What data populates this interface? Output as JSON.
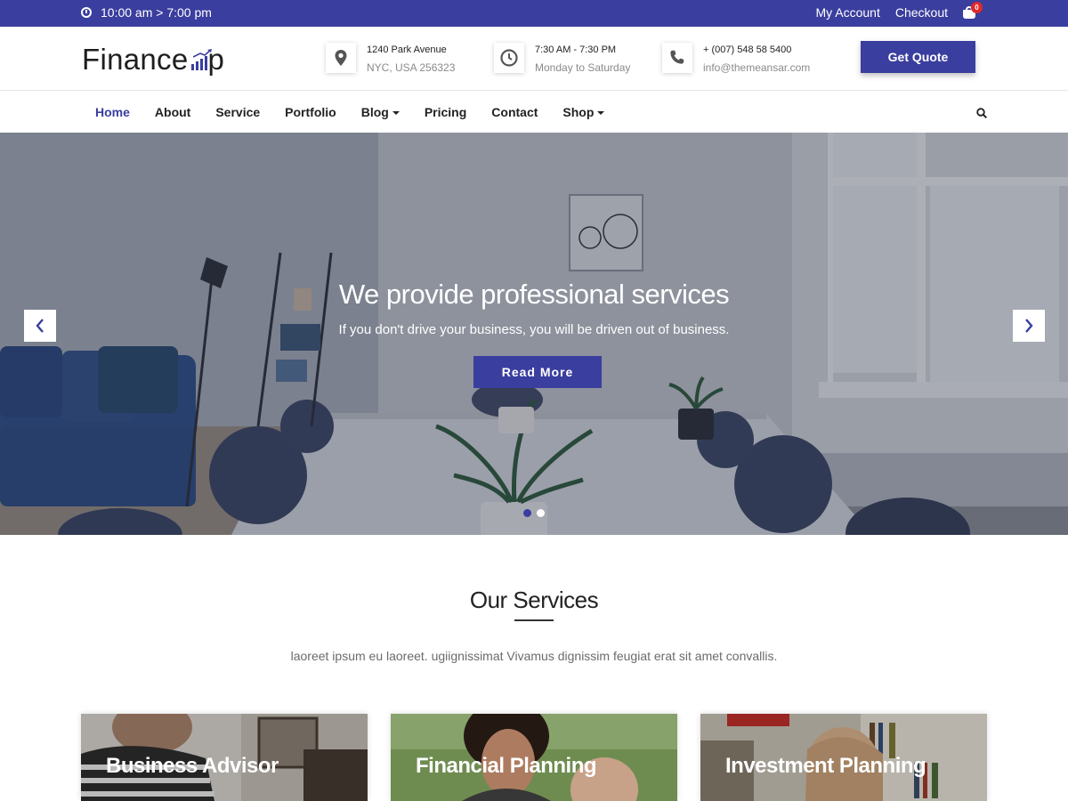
{
  "topbar": {
    "hours": "10:00 am > 7:00 pm",
    "my_account": "My Account",
    "checkout": "Checkout",
    "cart_count": "0"
  },
  "header": {
    "logo_text": "Finance",
    "logo_text_end": "p",
    "address": {
      "line1": "1240 Park Avenue",
      "line2": "NYC, USA 256323"
    },
    "hours": {
      "line1": "7:30 AM - 7:30 PM",
      "line2": "Monday to Saturday"
    },
    "contact": {
      "line1": "+ (007) 548 58 5400",
      "line2": "info@themeansar.com"
    },
    "quote_button": "Get Quote"
  },
  "nav": {
    "items": [
      {
        "label": "Home",
        "active": true,
        "dropdown": false
      },
      {
        "label": "About",
        "active": false,
        "dropdown": false
      },
      {
        "label": "Service",
        "active": false,
        "dropdown": false
      },
      {
        "label": "Portfolio",
        "active": false,
        "dropdown": false
      },
      {
        "label": "Blog",
        "active": false,
        "dropdown": true
      },
      {
        "label": "Pricing",
        "active": false,
        "dropdown": false
      },
      {
        "label": "Contact",
        "active": false,
        "dropdown": false
      },
      {
        "label": "Shop",
        "active": false,
        "dropdown": true
      }
    ]
  },
  "hero": {
    "title": "We provide professional services",
    "subtitle": "If you don't drive your business, you will be driven out of business.",
    "button": "Read More",
    "slide_count": 2,
    "active_slide": 0
  },
  "services": {
    "title": "Our Services",
    "description": "laoreet ipsum eu laoreet. ugiignissimat Vivamus dignissim feugiat erat sit amet convallis.",
    "cards": [
      {
        "title": "Business Advisor"
      },
      {
        "title": "Financial Planning"
      },
      {
        "title": "Investment Planning"
      }
    ]
  },
  "colors": {
    "brand": "#3a3e9e",
    "badge": "#e0282a"
  }
}
